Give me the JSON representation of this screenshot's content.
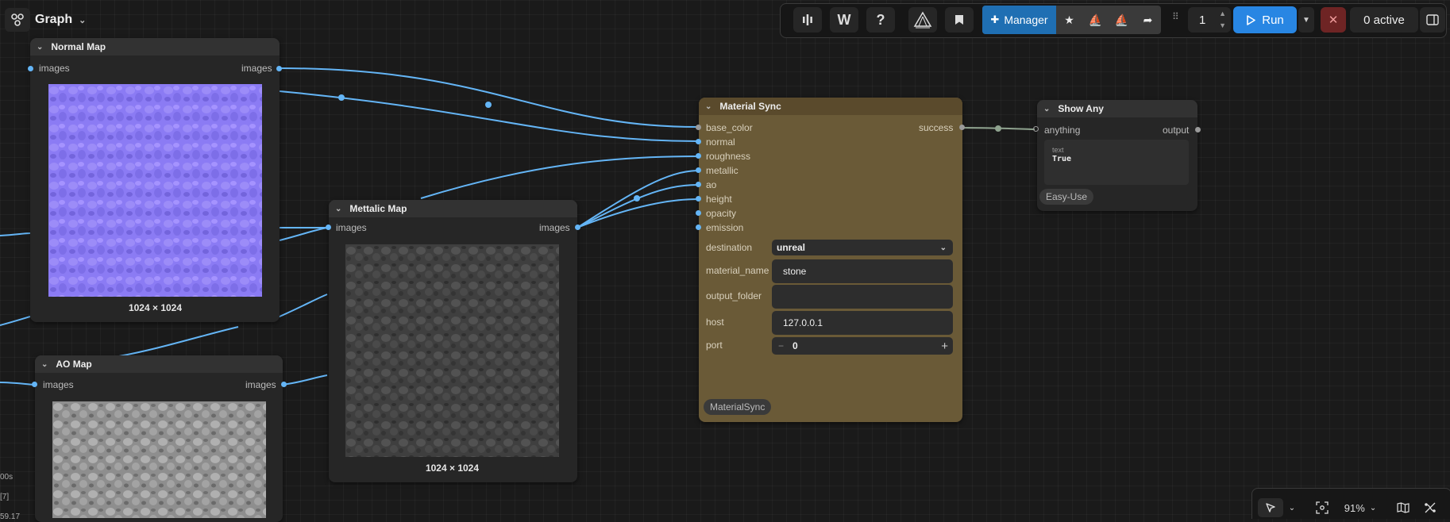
{
  "app": {
    "title": "Graph"
  },
  "toolbar": {
    "w_label": "W",
    "help_label": "?",
    "manager_label": "Manager",
    "batch_count": "1",
    "run_label": "Run",
    "queue_status": "0 active"
  },
  "nodes": {
    "normal_map": {
      "title": "Normal Map",
      "input": "images",
      "output": "images",
      "size": "1024 × 1024"
    },
    "metallic_map": {
      "title": "Mettalic Map",
      "input": "images",
      "output": "images",
      "size": "1024 × 1024"
    },
    "ao_map": {
      "title": "AO Map",
      "input": "images",
      "output": "images"
    },
    "material_sync": {
      "title": "Material Sync",
      "inputs": [
        "base_color",
        "normal",
        "roughness",
        "metallic",
        "ao",
        "height",
        "opacity",
        "emission"
      ],
      "output": "success",
      "widgets": {
        "destination_label": "destination",
        "destination_value": "unreal",
        "material_name_label": "material_name",
        "material_name_value": "stone",
        "output_folder_label": "output_folder",
        "output_folder_value": "",
        "host_label": "host",
        "host_value": "127.0.0.1",
        "port_label": "port",
        "port_value": "0"
      },
      "badge": "MaterialSync",
      "color": "#6a5a37"
    },
    "show_any": {
      "title": "Show Any",
      "input": "anything",
      "output": "output",
      "text_label": "text",
      "text_value": "True",
      "badge": "Easy-Use"
    }
  },
  "log_fragments": [
    "00s",
    "[7]",
    "59.17"
  ],
  "canvas": {
    "zoom": "91%"
  },
  "colors": {
    "wire": "#64b5f6",
    "run": "#2886e3",
    "manager": "#1f6fb3",
    "cancel": "#6e2424"
  }
}
